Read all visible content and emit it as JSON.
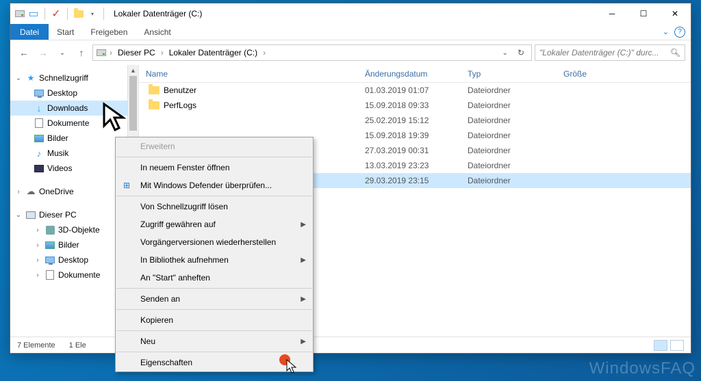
{
  "window": {
    "title": "Lokaler Datenträger (C:)"
  },
  "ribbon": {
    "file": "Datei",
    "tabs": [
      "Start",
      "Freigeben",
      "Ansicht"
    ]
  },
  "breadcrumb": {
    "root_icon": "pc",
    "items": [
      "Dieser PC",
      "Lokaler Datenträger (C:)"
    ]
  },
  "search": {
    "placeholder": "\"Lokaler Datenträger (C:)\" durc..."
  },
  "sidebar": {
    "quick_access": "Schnellzugriff",
    "quick_items": [
      {
        "icon": "monitor",
        "label": "Desktop"
      },
      {
        "icon": "download",
        "label": "Downloads"
      },
      {
        "icon": "doc",
        "label": "Dokumente"
      },
      {
        "icon": "pic",
        "label": "Bilder"
      },
      {
        "icon": "music",
        "label": "Musik"
      },
      {
        "icon": "video",
        "label": "Videos"
      }
    ],
    "onedrive": "OneDrive",
    "this_pc": "Dieser PC",
    "pc_items": [
      {
        "icon": "3d",
        "label": "3D-Objekte"
      },
      {
        "icon": "pic",
        "label": "Bilder"
      },
      {
        "icon": "monitor",
        "label": "Desktop"
      },
      {
        "icon": "doc",
        "label": "Dokumente"
      }
    ]
  },
  "columns": {
    "name": "Name",
    "date": "Änderungsdatum",
    "type": "Typ",
    "size": "Größe"
  },
  "files": [
    {
      "name": "Benutzer",
      "date": "01.03.2019 01:07",
      "type": "Dateiordner"
    },
    {
      "name": "PerfLogs",
      "date": "15.09.2018 09:33",
      "type": "Dateiordner"
    },
    {
      "name": "",
      "date": "25.02.2019 15:12",
      "type": "Dateiordner"
    },
    {
      "name": "",
      "date": "15.09.2018 19:39",
      "type": "Dateiordner"
    },
    {
      "name": "",
      "date": "27.03.2019 00:31",
      "type": "Dateiordner"
    },
    {
      "name": "",
      "date": "13.03.2019 23:23",
      "type": "Dateiordner"
    },
    {
      "name": "",
      "date": "29.03.2019 23:15",
      "type": "Dateiordner",
      "selected": true
    }
  ],
  "context_menu": [
    {
      "label": "Erweitern",
      "disabled": true
    },
    {
      "sep": true
    },
    {
      "label": "In neuem Fenster öffnen"
    },
    {
      "label": "Mit Windows Defender überprüfen...",
      "icon": "shield"
    },
    {
      "sep": true
    },
    {
      "label": "Von Schnellzugriff lösen"
    },
    {
      "label": "Zugriff gewähren auf",
      "submenu": true
    },
    {
      "label": "Vorgängerversionen wiederherstellen"
    },
    {
      "label": "In Bibliothek aufnehmen",
      "submenu": true
    },
    {
      "label": "An \"Start\" anheften"
    },
    {
      "sep": true
    },
    {
      "label": "Senden an",
      "submenu": true
    },
    {
      "sep": true
    },
    {
      "label": "Kopieren"
    },
    {
      "sep": true
    },
    {
      "label": "Neu",
      "submenu": true
    },
    {
      "sep": true
    },
    {
      "label": "Eigenschaften"
    }
  ],
  "statusbar": {
    "count": "7 Elemente",
    "selected": "1 Ele"
  },
  "watermark": "WindowsFAQ"
}
